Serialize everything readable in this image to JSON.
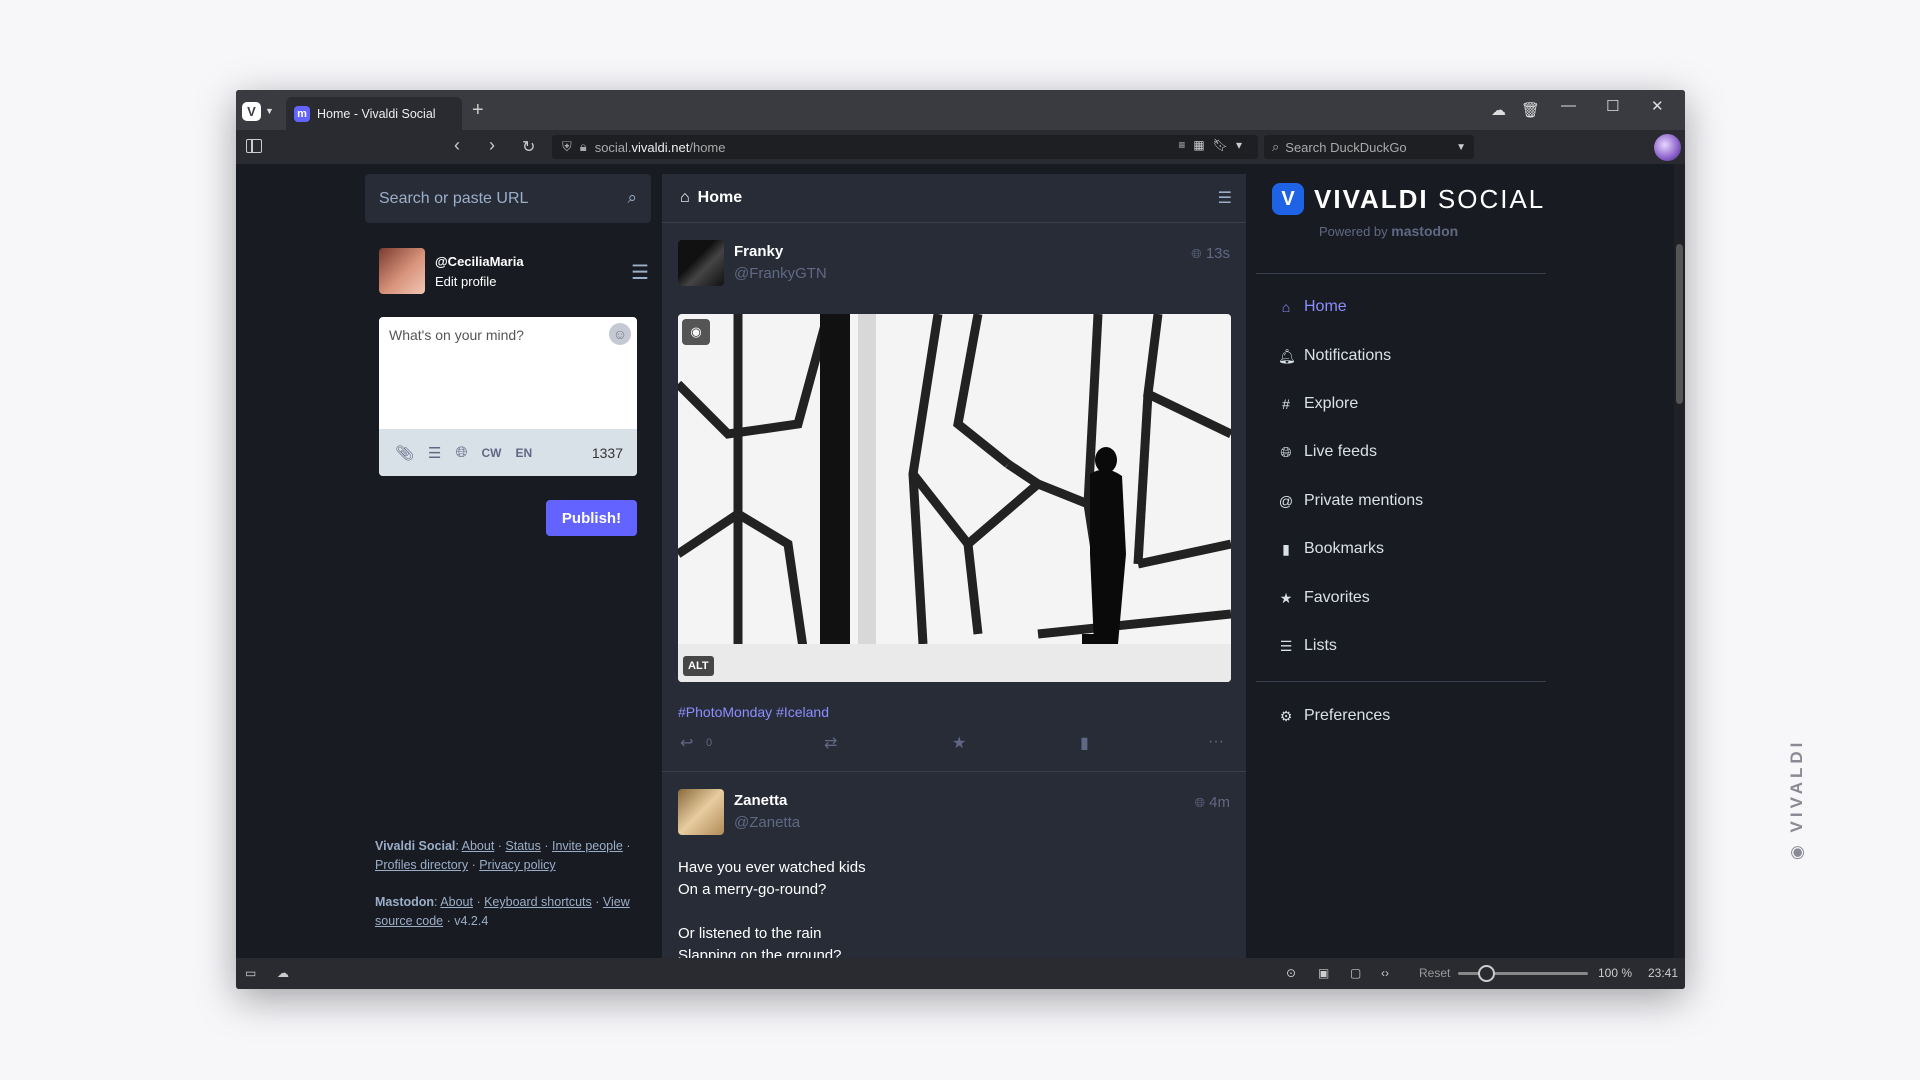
{
  "browser": {
    "tab_title": "Home - Vivaldi Social",
    "url_prefix": "social.",
    "url_domain": "vivaldi.net",
    "url_path": "/home",
    "search_placeholder": "Search DuckDuckGo",
    "zoom_reset": "Reset",
    "zoom_level": "100 %",
    "clock": "23:41"
  },
  "left": {
    "search_placeholder": "Search or paste URL",
    "user_handle": "@CeciliaMaria",
    "edit_profile": "Edit profile",
    "compose_placeholder": "What's on your mind?",
    "cw": "CW",
    "lang": "EN",
    "char_count": "1337",
    "publish": "Publish!"
  },
  "footer": {
    "vs_label": "Vivaldi Social",
    "about": "About",
    "status": "Status",
    "invite": "Invite people",
    "profiles": "Profiles directory",
    "privacy": "Privacy policy",
    "mastodon_label": "Mastodon",
    "about2": "About",
    "shortcuts": "Keyboard shortcuts",
    "source": "View source code",
    "version": "v4.2.4"
  },
  "column": {
    "title": "Home"
  },
  "posts": [
    {
      "name": "Franky",
      "handle": "@FrankyGTN",
      "time": "13s",
      "alt_badge": "ALT",
      "tags": "#PhotoMonday #Iceland",
      "reply_count": "0"
    },
    {
      "name": "Zanetta",
      "handle": "@Zanetta",
      "time": "4m",
      "lines": [
        "Have you ever watched kids",
        "On a merry-go-round?",
        "",
        "Or listened to the rain",
        "Slapping on the ground?"
      ]
    }
  ],
  "brand": {
    "name_bold": "VIVALDI",
    "name_light": "SOCIAL",
    "powered_by": "Powered by",
    "mastodon": "mastodon"
  },
  "nav": [
    {
      "label": "Home",
      "icon": "home-icon"
    },
    {
      "label": "Notifications",
      "icon": "bell-icon"
    },
    {
      "label": "Explore",
      "icon": "hashtag-icon"
    },
    {
      "label": "Live feeds",
      "icon": "globe-icon"
    },
    {
      "label": "Private mentions",
      "icon": "at-icon"
    },
    {
      "label": "Bookmarks",
      "icon": "bookmark-icon"
    },
    {
      "label": "Favorites",
      "icon": "star-icon"
    },
    {
      "label": "Lists",
      "icon": "list-icon"
    },
    {
      "label": "Preferences",
      "icon": "gear-icon"
    }
  ],
  "watermark": "VIVALDI",
  "colors": {
    "accent": "#6364ff",
    "link": "#8c8dff",
    "bg": "#191b22",
    "panel": "#282c37"
  }
}
